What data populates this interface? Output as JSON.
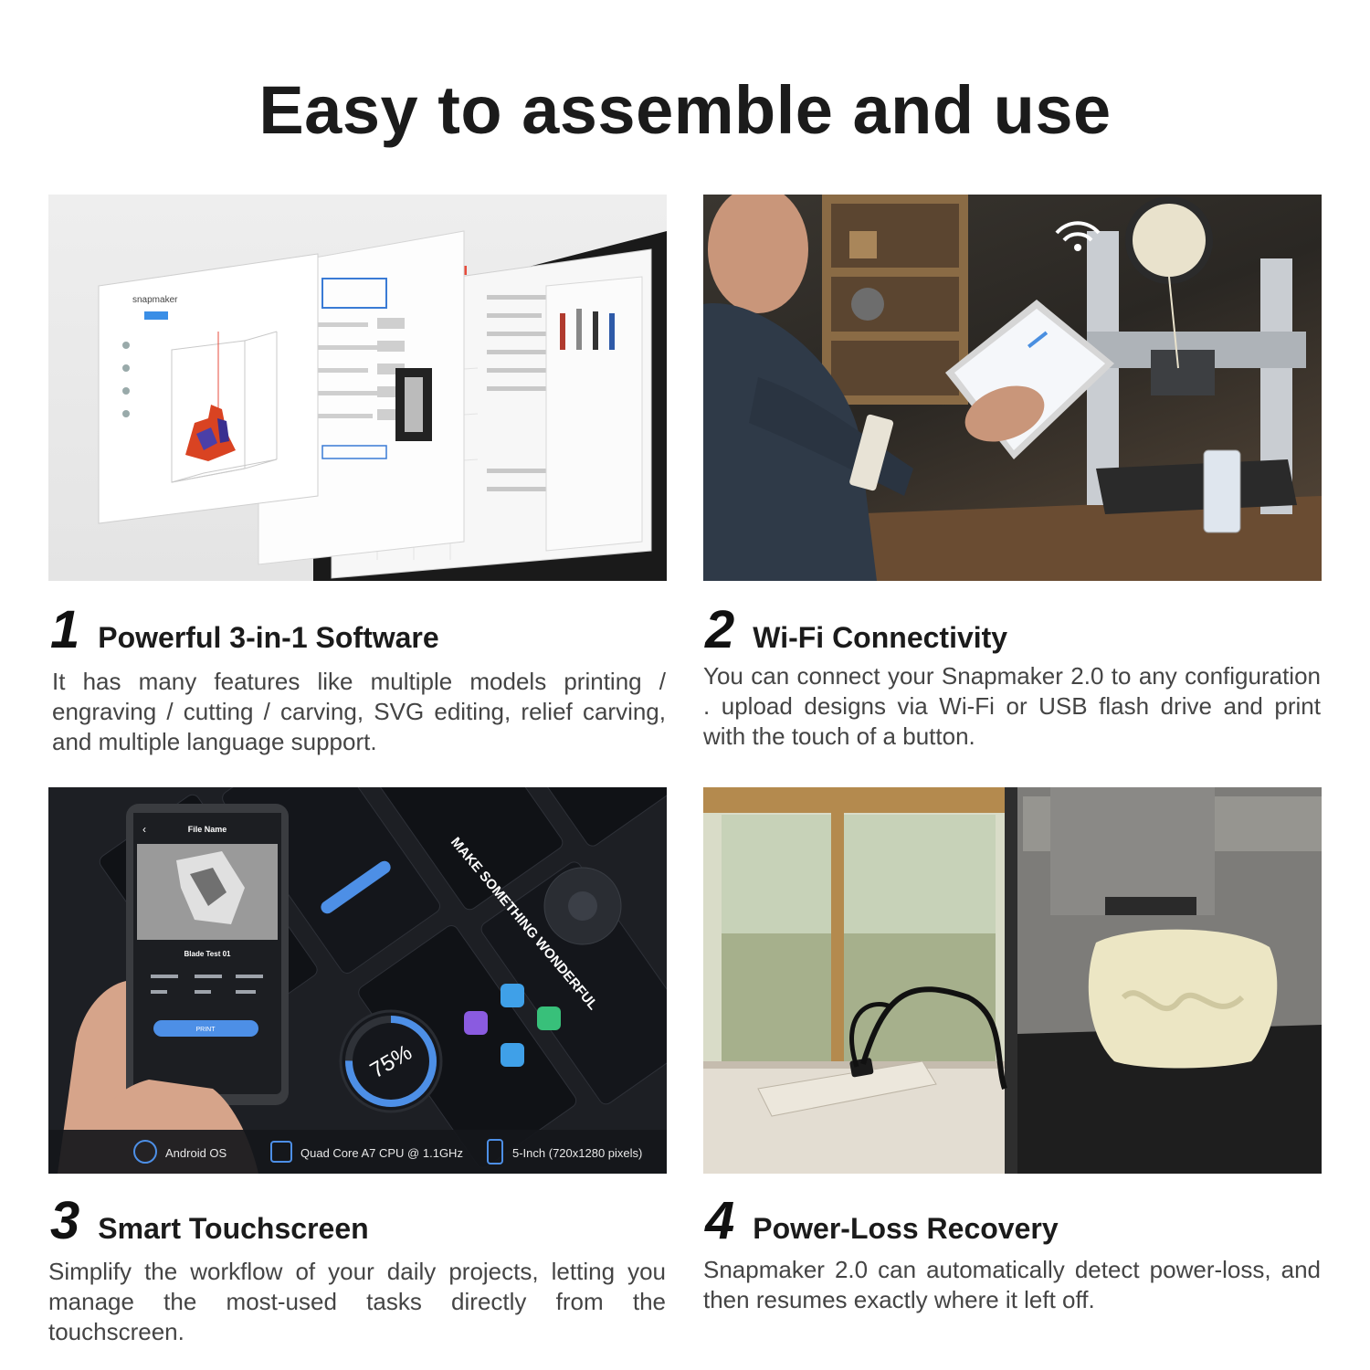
{
  "title": "Easy to assemble and use",
  "features": [
    {
      "number": "1",
      "heading": "Powerful 3-in-1 Software",
      "description": "It has many features like multiple models printing / engraving / cutting / carving, SVG editing, relief carving, and multiple language support."
    },
    {
      "number": "2",
      "heading": "Wi-Fi Connectivity",
      "description": "You can connect your Snapmaker 2.0 to any configuration . upload designs via Wi-Fi or USB flash drive and print with the touch of a button."
    },
    {
      "number": "3",
      "heading": "Smart Touchscreen",
      "description": "Simplify the workflow of your daily projects, letting you manage the most-used tasks directly from the touchscreen."
    },
    {
      "number": "4",
      "heading": "Power-Loss Recovery",
      "description": "Snapmaker 2.0 can automatically detect power-loss, and then resumes exactly where it left off."
    }
  ],
  "touchscreen": {
    "file_name": "File Name",
    "model_name": "Blade Test 01",
    "print_label": "PRINT",
    "progress": "75%",
    "slogan": "MAKE SOMETHING WONDERFUL",
    "specs": [
      "Android OS",
      "Quad Core A7 CPU @ 1.1GHz",
      "5-Inch (720x1280 pixels)"
    ]
  },
  "software": {
    "brand": "snapmaker"
  }
}
